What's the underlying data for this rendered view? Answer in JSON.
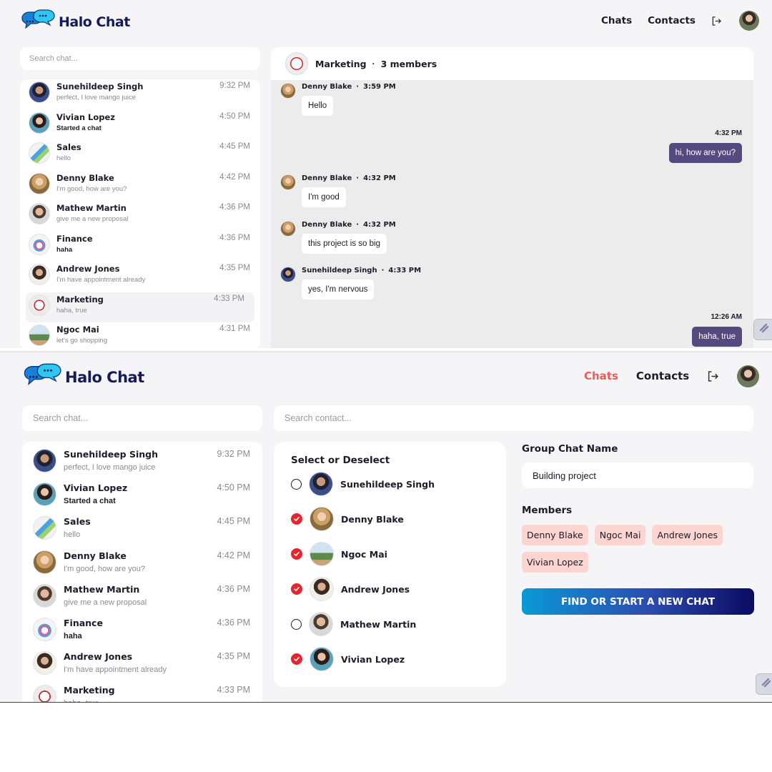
{
  "app": {
    "title": "Halo Chat",
    "nav": {
      "chats": "Chats",
      "contacts": "Contacts"
    }
  },
  "colors": {
    "brand": "#161a57",
    "nav_active": "#ef5a5a",
    "my_bubble": "#544a7d",
    "chip": "#fcd5d0",
    "check": "#e8242e"
  },
  "icons": [
    "chat-bubbles-logo-icon",
    "logout-icon",
    "checkmark-icon",
    "link-icon"
  ],
  "chat_list": [
    {
      "name": "Sunehildeep Singh",
      "last": "perfect, I love mango juice",
      "time": "9:32 PM",
      "unread": false
    },
    {
      "name": "Vivian Lopez",
      "last": "Started a chat",
      "time": "4:50 PM",
      "unread": true
    },
    {
      "name": "Sales",
      "last": "hello",
      "time": "4:45 PM",
      "unread": false
    },
    {
      "name": "Denny Blake",
      "last": "I'm good, how are you?",
      "time": "4:42 PM",
      "unread": false
    },
    {
      "name": "Mathew Martin",
      "last": "give me a new proposal",
      "time": "4:36 PM",
      "unread": false
    },
    {
      "name": "Finance",
      "last": "haha",
      "time": "4:36 PM",
      "unread": true
    },
    {
      "name": "Andrew Jones",
      "last": "I'm have appointment already",
      "time": "4:35 PM",
      "unread": false
    },
    {
      "name": "Marketing",
      "last": "haha, true",
      "time": "4:33 PM",
      "unread": false
    },
    {
      "name": "Ngoc Mai",
      "last": "let's go shopping",
      "time": "4:31 PM",
      "unread": false
    }
  ],
  "screen1": {
    "search_placeholder": "Search chat...",
    "header": {
      "name": "Marketing",
      "members": "3 members"
    },
    "messages": [
      {
        "sender": "Denny Blake",
        "time": "3:59 PM",
        "text": "Hello",
        "mine": false
      },
      {
        "sender": "",
        "time": "4:32 PM",
        "text": "hi, how are you?",
        "mine": true
      },
      {
        "sender": "Denny Blake",
        "time": "4:32 PM",
        "text": "I'm good",
        "mine": false
      },
      {
        "sender": "Denny Blake",
        "time": "4:32 PM",
        "text": "this project is so big",
        "mine": false
      },
      {
        "sender": "Sunehildeep Singh",
        "time": "4:33 PM",
        "text": "yes, I'm nervous",
        "mine": false
      },
      {
        "sender": "",
        "time": "12:26 AM",
        "text": "haha, true",
        "mine": true
      }
    ]
  },
  "screen2": {
    "search_chat_placeholder": "Search chat...",
    "search_contact_placeholder": "Search contact...",
    "select_title": "Select or Deselect",
    "contacts": [
      {
        "name": "Sunehildeep Singh",
        "selected": false
      },
      {
        "name": "Denny Blake",
        "selected": true
      },
      {
        "name": "Ngoc Mai",
        "selected": true
      },
      {
        "name": "Andrew Jones",
        "selected": true
      },
      {
        "name": "Mathew Martin",
        "selected": false
      },
      {
        "name": "Vivian Lopez",
        "selected": true
      }
    ],
    "group_name_label": "Group Chat Name",
    "group_name_value": "Building project",
    "members_label": "Members",
    "members": [
      "Denny Blake",
      "Ngoc Mai",
      "Andrew Jones",
      "Vivian Lopez"
    ],
    "cta": "FIND OR START A NEW CHAT"
  }
}
